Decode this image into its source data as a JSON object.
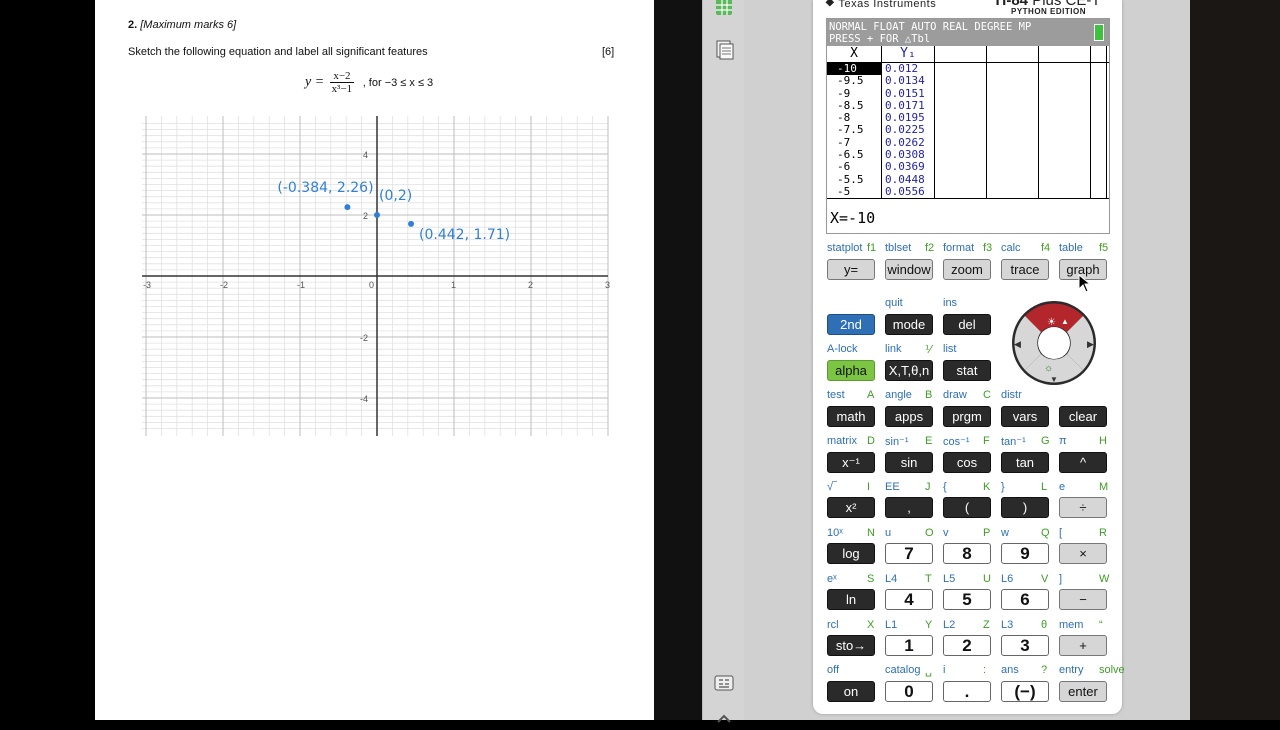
{
  "worksheet": {
    "question_number": "2.",
    "marks_note": "[Maximum marks 6]",
    "instruction": "Sketch the following equation and label all significant features",
    "marks": "[6]",
    "equation": {
      "lhs": "y =",
      "numerator": "x−2",
      "denominator": "x³−1",
      "domain": ", for  −3 ≤ x ≤ 3"
    },
    "graph": {
      "x_ticks": [
        "-3",
        "-2",
        "-1",
        "0",
        "1",
        "2",
        "3"
      ],
      "y_ticks": [
        "4",
        "2",
        "-2",
        "-4"
      ],
      "annotations": [
        {
          "text": "(-0.384, 2.26)"
        },
        {
          "text": "(0,2)"
        },
        {
          "text": "(0.442, 1.71)"
        }
      ],
      "points": [
        {
          "x": -0.384,
          "y": 2.26
        },
        {
          "x": 0,
          "y": 2
        },
        {
          "x": 0.442,
          "y": 1.71
        }
      ],
      "ink_color": "#2f7fd8"
    }
  },
  "calculator": {
    "brand": "Texas Instruments",
    "model": "TI-84",
    "model_suffix": "Plus CE-T",
    "edition": "PYTHON EDITION",
    "status_line1": "NORMAL FLOAT AUTO REAL DEGREE MP",
    "status_line2": "PRESS + FOR △Tbl",
    "table_headers": [
      "X",
      "Y₁"
    ],
    "x_values": [
      "-10",
      "-9.5",
      "-9",
      "-8.5",
      "-8",
      "-7.5",
      "-7",
      "-6.5",
      "-6",
      "-5.5",
      "-5"
    ],
    "y_values": [
      "0.012",
      "0.0134",
      "0.0151",
      "0.0171",
      "0.0195",
      "0.0225",
      "0.0262",
      "0.0308",
      "0.0369",
      "0.0448",
      "0.0556"
    ],
    "entry_line": "X=-10",
    "colors": {
      "screen_status": "#9c9c9c",
      "y_value_text": "#1f1fa8",
      "second_key": "#2e6fb5",
      "alpha_key": "#7cc544",
      "dpad_up": "#b3262b"
    },
    "function_row": {
      "labels": [
        {
          "left": "statplot",
          "right": "f1"
        },
        {
          "left": "tblset",
          "right": "f2"
        },
        {
          "left": "format",
          "right": "f3"
        },
        {
          "left": "calc",
          "right": "f4"
        },
        {
          "left": "table",
          "right": "f5"
        }
      ],
      "keys": [
        "y=",
        "window",
        "zoom",
        "trace",
        "graph"
      ]
    },
    "row2": {
      "labels": [
        {
          "left": "",
          "right": ""
        },
        {
          "left": "quit",
          "right": ""
        },
        {
          "left": "ins",
          "right": ""
        }
      ],
      "keys": [
        "2nd",
        "mode",
        "del"
      ]
    },
    "row3": {
      "labels": [
        {
          "left": "A-lock",
          "right": ""
        },
        {
          "left": "link",
          "right": "⅟"
        },
        {
          "left": "list",
          "right": ""
        }
      ],
      "keys": [
        "alpha",
        "X,T,θ,n",
        "stat"
      ]
    },
    "row4": {
      "labels": [
        {
          "left": "test",
          "right": "A"
        },
        {
          "left": "angle",
          "right": "B"
        },
        {
          "left": "draw",
          "right": "C"
        },
        {
          "left": "distr",
          "right": ""
        },
        {
          "left": "",
          "right": ""
        }
      ],
      "keys": [
        "math",
        "apps",
        "prgm",
        "vars",
        "clear"
      ]
    },
    "row5": {
      "labels": [
        {
          "left": "matrix",
          "right": "D"
        },
        {
          "left": "sin⁻¹",
          "right": "E"
        },
        {
          "left": "cos⁻¹",
          "right": "F"
        },
        {
          "left": "tan⁻¹",
          "right": "G"
        },
        {
          "left": "π",
          "right": "H"
        }
      ],
      "keys": [
        "x⁻¹",
        "sin",
        "cos",
        "tan",
        "^"
      ]
    },
    "row6": {
      "labels": [
        {
          "left": "√‾",
          "right": "I"
        },
        {
          "left": "EE",
          "right": "J"
        },
        {
          "left": "{",
          "right": "K"
        },
        {
          "left": "}",
          "right": "L"
        },
        {
          "left": "e",
          "right": "M"
        }
      ],
      "keys": [
        "x²",
        ",",
        "(",
        ")",
        "÷"
      ]
    },
    "row7": {
      "labels": [
        {
          "left": "10ˣ",
          "right": "N"
        },
        {
          "left": "u",
          "right": "O"
        },
        {
          "left": "v",
          "right": "P"
        },
        {
          "left": "w",
          "right": "Q"
        },
        {
          "left": "[",
          "right": "R"
        }
      ],
      "keys": [
        "log",
        "7",
        "8",
        "9",
        "×"
      ]
    },
    "row8": {
      "labels": [
        {
          "left": "eˣ",
          "right": "S"
        },
        {
          "left": "L4",
          "right": "T"
        },
        {
          "left": "L5",
          "right": "U"
        },
        {
          "left": "L6",
          "right": "V"
        },
        {
          "left": "]",
          "right": "W"
        }
      ],
      "keys": [
        "ln",
        "4",
        "5",
        "6",
        "−"
      ]
    },
    "row9": {
      "labels": [
        {
          "left": "rcl",
          "right": "X"
        },
        {
          "left": "L1",
          "right": "Y"
        },
        {
          "left": "L2",
          "right": "Z"
        },
        {
          "left": "L3",
          "right": "θ"
        },
        {
          "left": "mem",
          "right": "“"
        }
      ],
      "keys": [
        "sto→",
        "1",
        "2",
        "3",
        "+"
      ]
    },
    "row10": {
      "labels": [
        {
          "left": "off",
          "right": ""
        },
        {
          "left": "catalog",
          "right": "␣"
        },
        {
          "left": "i",
          "right": ":"
        },
        {
          "left": "ans",
          "right": "?"
        },
        {
          "left": "entry",
          "right": "solve"
        }
      ],
      "keys": [
        "on",
        "0",
        ".",
        "(−)",
        "enter"
      ]
    }
  }
}
